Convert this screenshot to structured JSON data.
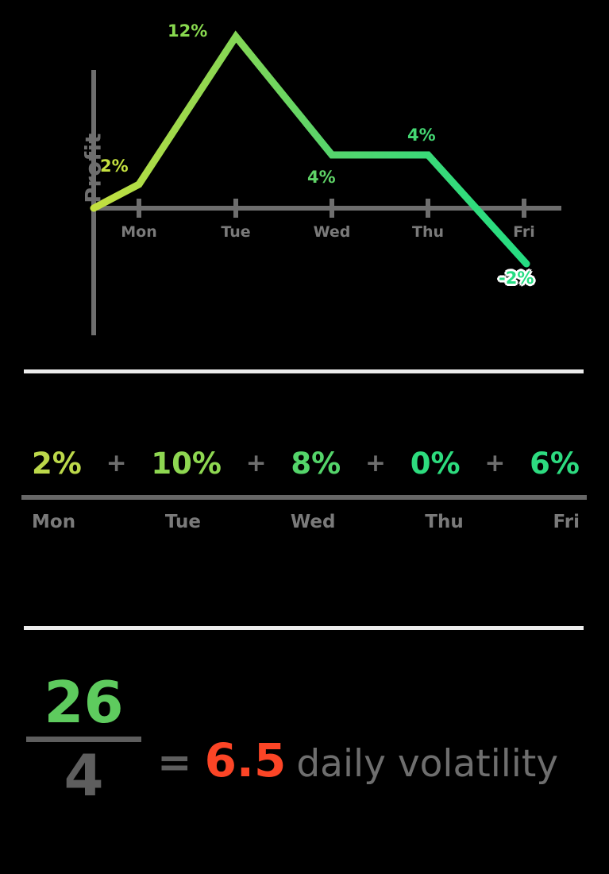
{
  "chart_data": {
    "type": "line",
    "title": "",
    "xlabel": "",
    "ylabel": "Profit",
    "categories": [
      "Mon",
      "Tue",
      "Wed",
      "Thu",
      "Fri"
    ],
    "values": [
      2,
      12,
      4,
      4,
      -2
    ],
    "value_labels": [
      "2%",
      "12%",
      "4%",
      "4%",
      "-2%"
    ],
    "series": [
      {
        "name": "Profit",
        "values": [
          2,
          12,
          4,
          4,
          -2
        ]
      }
    ],
    "origin_value": 0,
    "ylim": [
      -3,
      13
    ],
    "grid": false,
    "legend": false,
    "line_gradient_start": "#c4e03f",
    "line_gradient_end": "#25dd82",
    "axis_color": "#6e6e6e"
  },
  "chart": {
    "y_axis_label": "Profit",
    "ticks": [
      {
        "label": "Mon"
      },
      {
        "label": "Tue"
      },
      {
        "label": "Wed"
      },
      {
        "label": "Thu"
      },
      {
        "label": "Fri"
      }
    ],
    "point_labels": [
      {
        "text": "2%",
        "color": "#c4e03f"
      },
      {
        "text": "12%",
        "color": "#88d94f"
      },
      {
        "text": "4%",
        "color": "#5fd367"
      },
      {
        "text": "4%",
        "color": "#44d873"
      },
      {
        "text": "-2%",
        "color": "#25dd82"
      }
    ]
  },
  "sum": {
    "terms": [
      {
        "value": "2%",
        "color": "#bcd84a",
        "day": "Mon"
      },
      {
        "value": "10%",
        "color": "#8ed751",
        "day": "Tue"
      },
      {
        "value": "8%",
        "color": "#54d46a",
        "day": "Wed"
      },
      {
        "value": "0%",
        "color": "#2ddc7e",
        "day": "Thu"
      },
      {
        "value": "6%",
        "color": "#2ddb80",
        "day": "Fri"
      }
    ],
    "operator": "+"
  },
  "result": {
    "numerator": "26",
    "numerator_color": "#5ecb5e",
    "denominator": "4",
    "equals": "=",
    "value": "6.5",
    "value_color": "#fc4526",
    "caption": "daily volatility"
  },
  "colors": {
    "background": "#000000",
    "divider_white": "#ededed",
    "divider_gray": "#676767",
    "muted_text": "#6e6e6e",
    "accent_red": "#fc4526",
    "accent_green": "#5ecb5e"
  }
}
